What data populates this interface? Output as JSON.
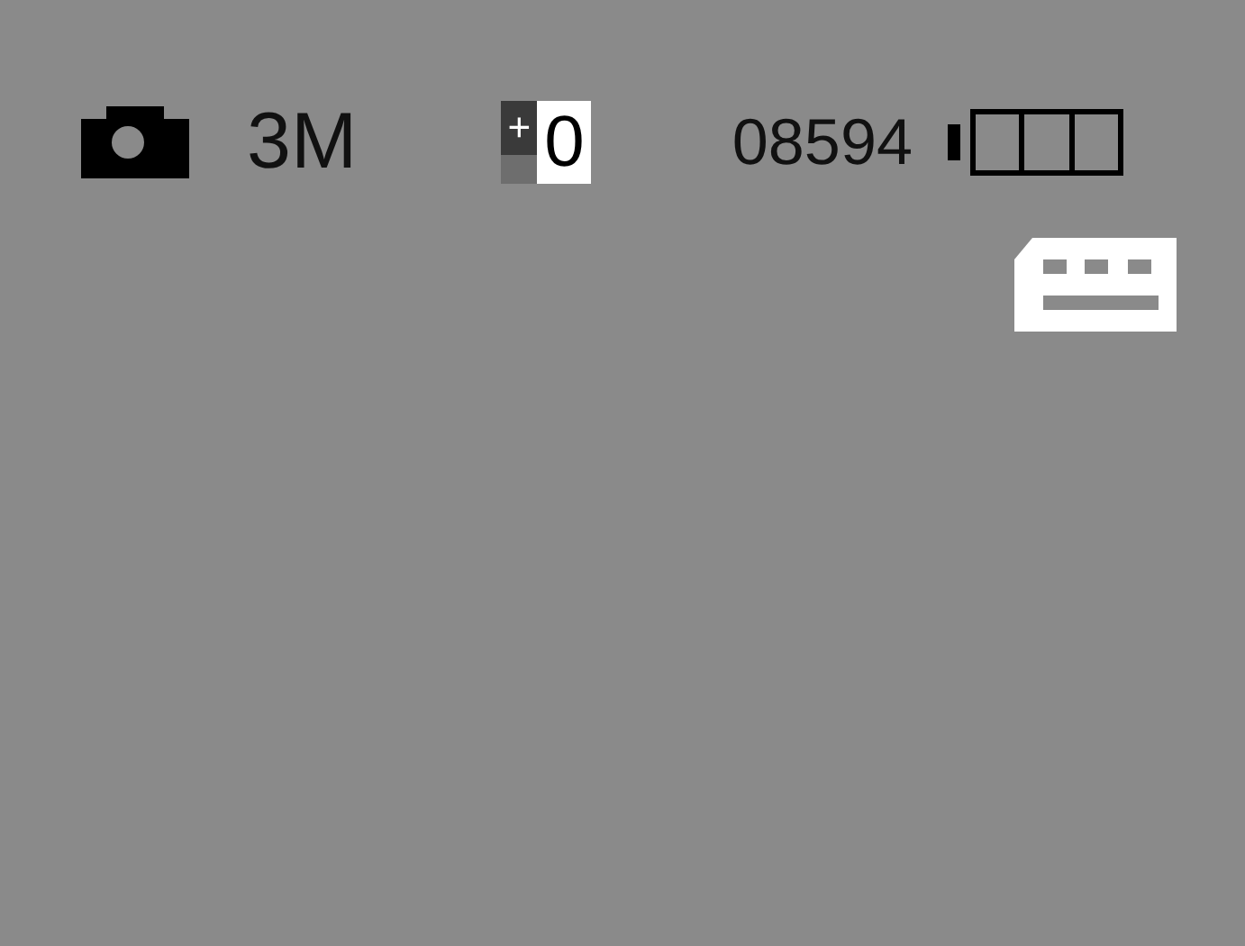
{
  "status_bar": {
    "resolution": "3M",
    "exposure_sign": "+",
    "exposure_value": "0",
    "shots_remaining": "08594"
  }
}
